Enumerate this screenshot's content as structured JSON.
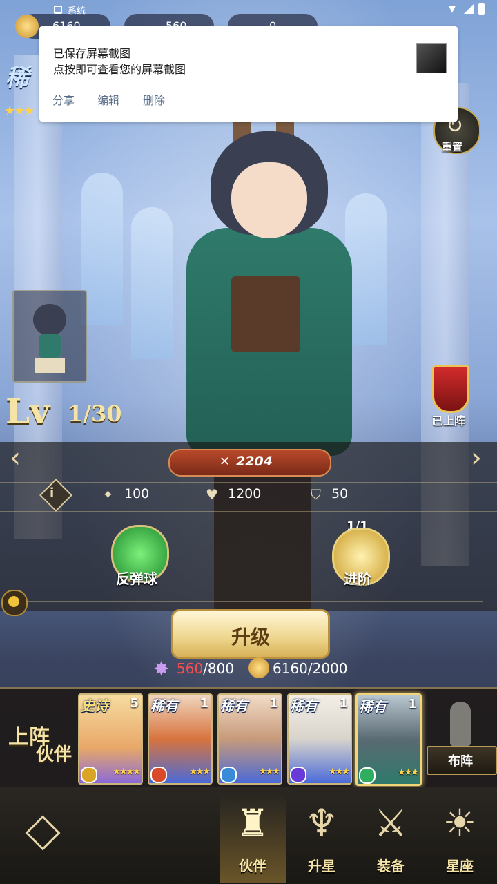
{
  "status_bar": {
    "app_label": "系统"
  },
  "currency": {
    "coins": "6160",
    "gems": "560",
    "crystals": "0"
  },
  "notification": {
    "title": "已保存屏幕截图",
    "body": "点按即可查看您的屏幕截图",
    "actions": [
      "分享",
      "编辑",
      "删除"
    ]
  },
  "hero": {
    "rarity": "稀",
    "stars": "★★★",
    "reset_label": "重置",
    "level_prefix": "Lv",
    "level": "1/30",
    "on_team_label": "已上阵",
    "power": "2204",
    "stats": {
      "attack": "100",
      "hp": "1200",
      "defense": "50"
    }
  },
  "skills": [
    {
      "label": "反弹球",
      "color": "#2fae3f"
    },
    {
      "label": "进阶",
      "counter": "1/1",
      "color": "#d9b23c"
    }
  ],
  "upgrade": {
    "label": "升级",
    "gem_have": "560",
    "gem_need": "/800",
    "coin_text": "6160/2000"
  },
  "team": {
    "label_line1": "上阵",
    "label_line2": "伙伴",
    "formation_label": "布阵",
    "cards": [
      {
        "rarity": "史诗",
        "num": "5",
        "stars": "★★★★",
        "bg": "#f2c87a",
        "elem": "#d9a526"
      },
      {
        "rarity": "稀有",
        "num": "1",
        "stars": "★★★",
        "bg": "#d8743e",
        "elem": "#d84a2a"
      },
      {
        "rarity": "稀有",
        "num": "1",
        "stars": "★★★",
        "bg": "#c79a7a",
        "elem": "#3a8ad8"
      },
      {
        "rarity": "稀有",
        "num": "1",
        "stars": "★★★",
        "bg": "#d8d4cc",
        "elem": "#6a3ad8"
      },
      {
        "rarity": "稀有",
        "num": "1",
        "stars": "★★★",
        "bg": "#5a6a72",
        "elem": "#2fae5f"
      }
    ]
  },
  "bottom_nav": {
    "tabs": [
      {
        "label": "伙伴",
        "icon": "♜"
      },
      {
        "label": "升星",
        "icon": "♆"
      },
      {
        "label": "装备",
        "icon": "⚔"
      },
      {
        "label": "星座",
        "icon": "☀"
      }
    ]
  }
}
